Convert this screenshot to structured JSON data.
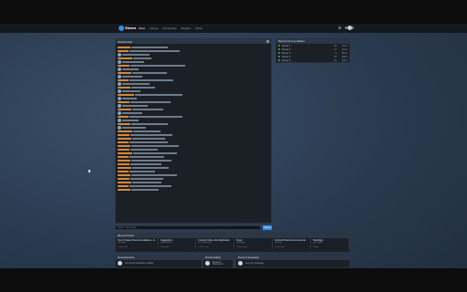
{
  "nav": {
    "logo": "Steam",
    "links": [
      "Store",
      "Library",
      "Community",
      "Support",
      "About"
    ],
    "active_index": 0
  },
  "chat": {
    "title": "Global Chat",
    "input_placeholder": "Enter message...",
    "send_label": "Send"
  },
  "servers": {
    "title": "Servers & Live Status",
    "rows": [
      {
        "name": "Server 1",
        "players": "24",
        "ping": "32ms"
      },
      {
        "name": "Server 2",
        "players": "17",
        "ping": "41ms"
      },
      {
        "name": "Server 3",
        "players": "9",
        "ping": "55ms"
      },
      {
        "name": "Server 4",
        "players": "31",
        "ping": "28ms"
      },
      {
        "name": "Server 5",
        "players": "12",
        "ping": "63ms"
      }
    ]
  },
  "recent": {
    "title": "Recent Posts",
    "items": [
      {
        "title": "Top 10 Steam Recommendations - E.",
        "sub": "by Player",
        "meta": "2 days ago"
      },
      {
        "title": "Suggestions",
        "sub": "by Moderator",
        "meta": "1 day ago"
      },
      {
        "title": "Friends Online Join Application",
        "sub": "by Community",
        "meta": "5 hours ago"
      },
      {
        "title": "News",
        "sub": "by Admin",
        "meta": "3 hours ago"
      },
      {
        "title": "Vertical Portal Announcements",
        "sub": "by Staff",
        "meta": "1 hour ago"
      },
      {
        "title": "Standings",
        "sub": "by League",
        "meta": "Today"
      }
    ]
  },
  "lower": {
    "left_title": "Announcements",
    "mid_title": "Friends Activity",
    "right_title": "Events & Giveaways",
    "left_item": "Community Guidelines Update",
    "mid_item": "Weekend Tournament",
    "right_item": "Free Key Giveaway"
  }
}
